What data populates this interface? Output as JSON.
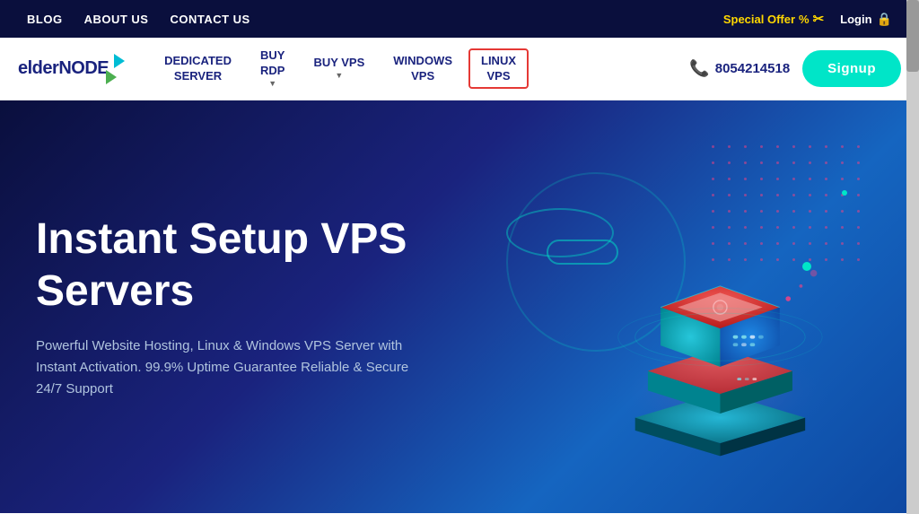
{
  "topbar": {
    "links": [
      {
        "label": "BLOG",
        "id": "blog"
      },
      {
        "label": "ABOUT US",
        "id": "about-us"
      },
      {
        "label": "CONTACT US",
        "id": "contact-us"
      }
    ],
    "special_offer_label": "Special Offer",
    "special_offer_symbol": "✂",
    "login_label": "Login",
    "lock_symbol": "🔒"
  },
  "navbar": {
    "logo_text_elder": "elder",
    "logo_text_node": "node",
    "links": [
      {
        "label": "DEDICATED\nSERVER",
        "id": "dedicated-server",
        "has_arrow": false
      },
      {
        "label": "BUY\nRDP",
        "id": "buy-rdp",
        "has_arrow": true
      },
      {
        "label": "BUY VPS",
        "id": "buy-vps",
        "has_arrow": true
      },
      {
        "label": "WINDOWS\nVPS",
        "id": "windows-vps",
        "has_arrow": false
      },
      {
        "label": "LINUX\nVPS",
        "id": "linux-vps",
        "has_arrow": false,
        "highlighted": true
      }
    ],
    "phone": "8054214518",
    "phone_icon": "📞",
    "signup_label": "Signup"
  },
  "hero": {
    "title": "Instant Setup VPS Servers",
    "subtitle": "Powerful Website Hosting, Linux & Windows VPS Server with Instant Activation. 99.9% Uptime Guarantee Reliable & Secure 24/7 Support"
  }
}
